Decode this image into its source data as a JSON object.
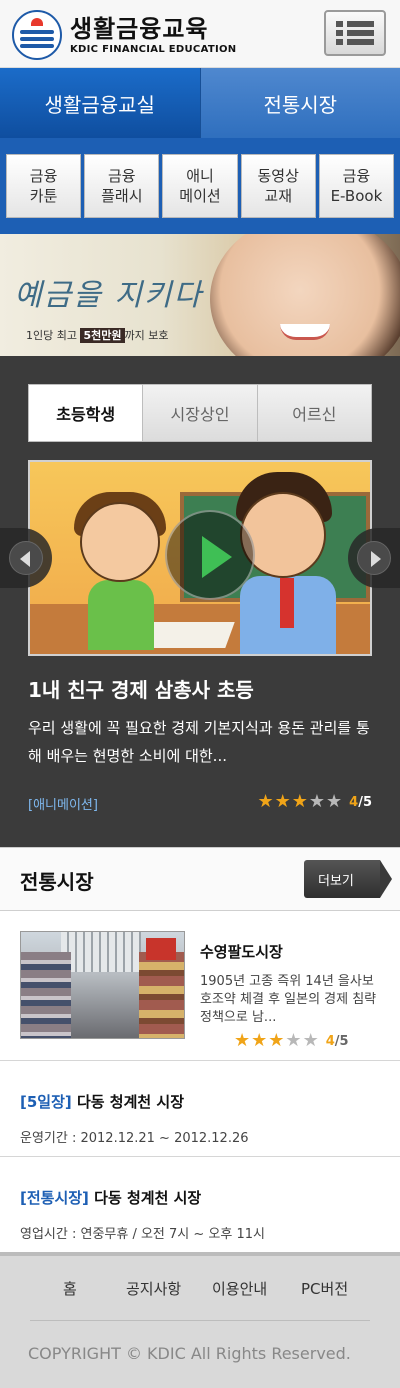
{
  "header": {
    "logo_title": "생활금융교육",
    "logo_subtitle": "KDIC FINANCIAL EDUCATION",
    "logo_icon": "kdic-emblem",
    "menu_icon": "list-menu-icon"
  },
  "main_tabs": [
    {
      "label": "생활금융교실",
      "active": true
    },
    {
      "label": "전통시장",
      "active": false
    }
  ],
  "sub_menu": [
    {
      "label": "금융\n카툰"
    },
    {
      "label": "금융\n플래시"
    },
    {
      "label": "애니\n메이션"
    },
    {
      "label": "동영상\n교재"
    },
    {
      "label": "금융\nE-Book"
    }
  ],
  "banner": {
    "title": "예금을 지키다",
    "caption_pre": "1인당 최고 ",
    "caption_highlight": "5천만원",
    "caption_post": "까지 보호"
  },
  "segment_tabs": [
    {
      "label": "초등학생",
      "active": true
    },
    {
      "label": "시장상인",
      "active": false
    },
    {
      "label": "어르신",
      "active": false
    }
  ],
  "featured": {
    "title": "1내 친구 경제 삼총사 초등",
    "description": "우리 생활에 꼭 필요한 경제 기본지식과 용돈 관리를 통해 배우는 현명한 소비에 대한...",
    "category": "[애니메이션]",
    "rating": 3,
    "rating_num": "4",
    "rating_total": "/5"
  },
  "market_section": {
    "title": "전통시장",
    "more_label": "더보기",
    "feature": {
      "name": "수영팔도시장",
      "description": "1905년 고종 즉위 14년 을사보호조약 체결 후 일본의 경제 침략 정책으로 남...",
      "rating": 3,
      "rating_num": "4",
      "rating_total": "/5"
    },
    "events": [
      {
        "tag": "[5일장]",
        "name": " 다동 청계천 시장",
        "info": "운영기간 : 2012.12.21 ~ 2012.12.26"
      },
      {
        "tag": "[전통시장]",
        "name": " 다동 청계천 시장",
        "info": "영업시간 : 연중무휴 / 오전 7시 ~ 오후 11시"
      }
    ]
  },
  "footer": {
    "links": [
      "홈",
      "공지사항",
      "이용안내",
      "PC버전"
    ],
    "copyright": "COPYRIGHT © KDIC All Rights Reserved."
  },
  "colors": {
    "brand_blue": "#1d5fb4",
    "star_on": "#f0a418",
    "category_link": "#7fb9f0"
  }
}
